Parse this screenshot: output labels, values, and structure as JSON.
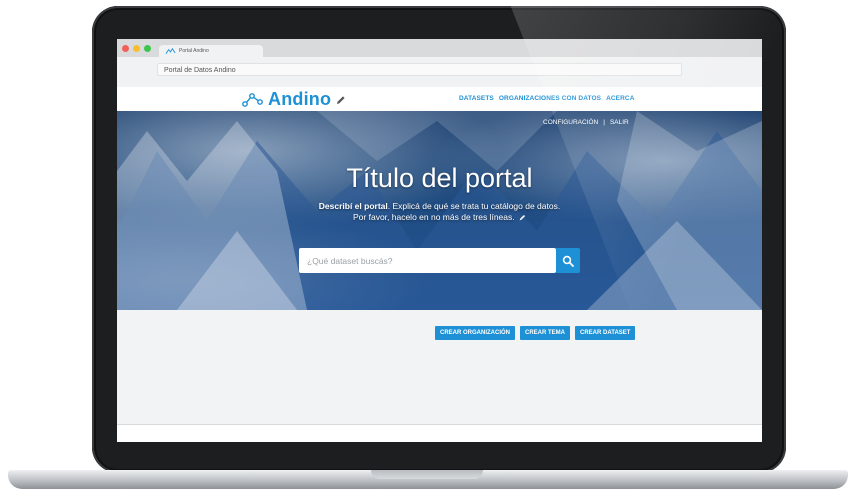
{
  "browser": {
    "tab_label": "Portal Andino",
    "address": "Portal de Datos Andino"
  },
  "header": {
    "logo_text": "Andino",
    "nav": [
      "DATASETS",
      "ORGANIZACIONES CON DATOS",
      "ACERCA"
    ]
  },
  "hero": {
    "links": [
      "CONFIGURACIÓN",
      "|",
      "SALIR"
    ],
    "title": "Título del portal",
    "desc_bold": "Describí el portal",
    "desc_rest": ". Explicá de qué se trata tu catálogo de datos.",
    "desc_line2": "Por favor, hacelo en no más de tres líneas.",
    "search_placeholder": "¿Qué dataset buscás?"
  },
  "actions": [
    "CREAR ORGANIZACIÓN",
    "CREAR TEMA",
    "CREAR DATASET"
  ],
  "colors": {
    "accent": "#1e90d6"
  },
  "icons": {
    "logo": "andino-logo-icon",
    "edit": "pencil-icon",
    "search": "magnifier-icon"
  }
}
